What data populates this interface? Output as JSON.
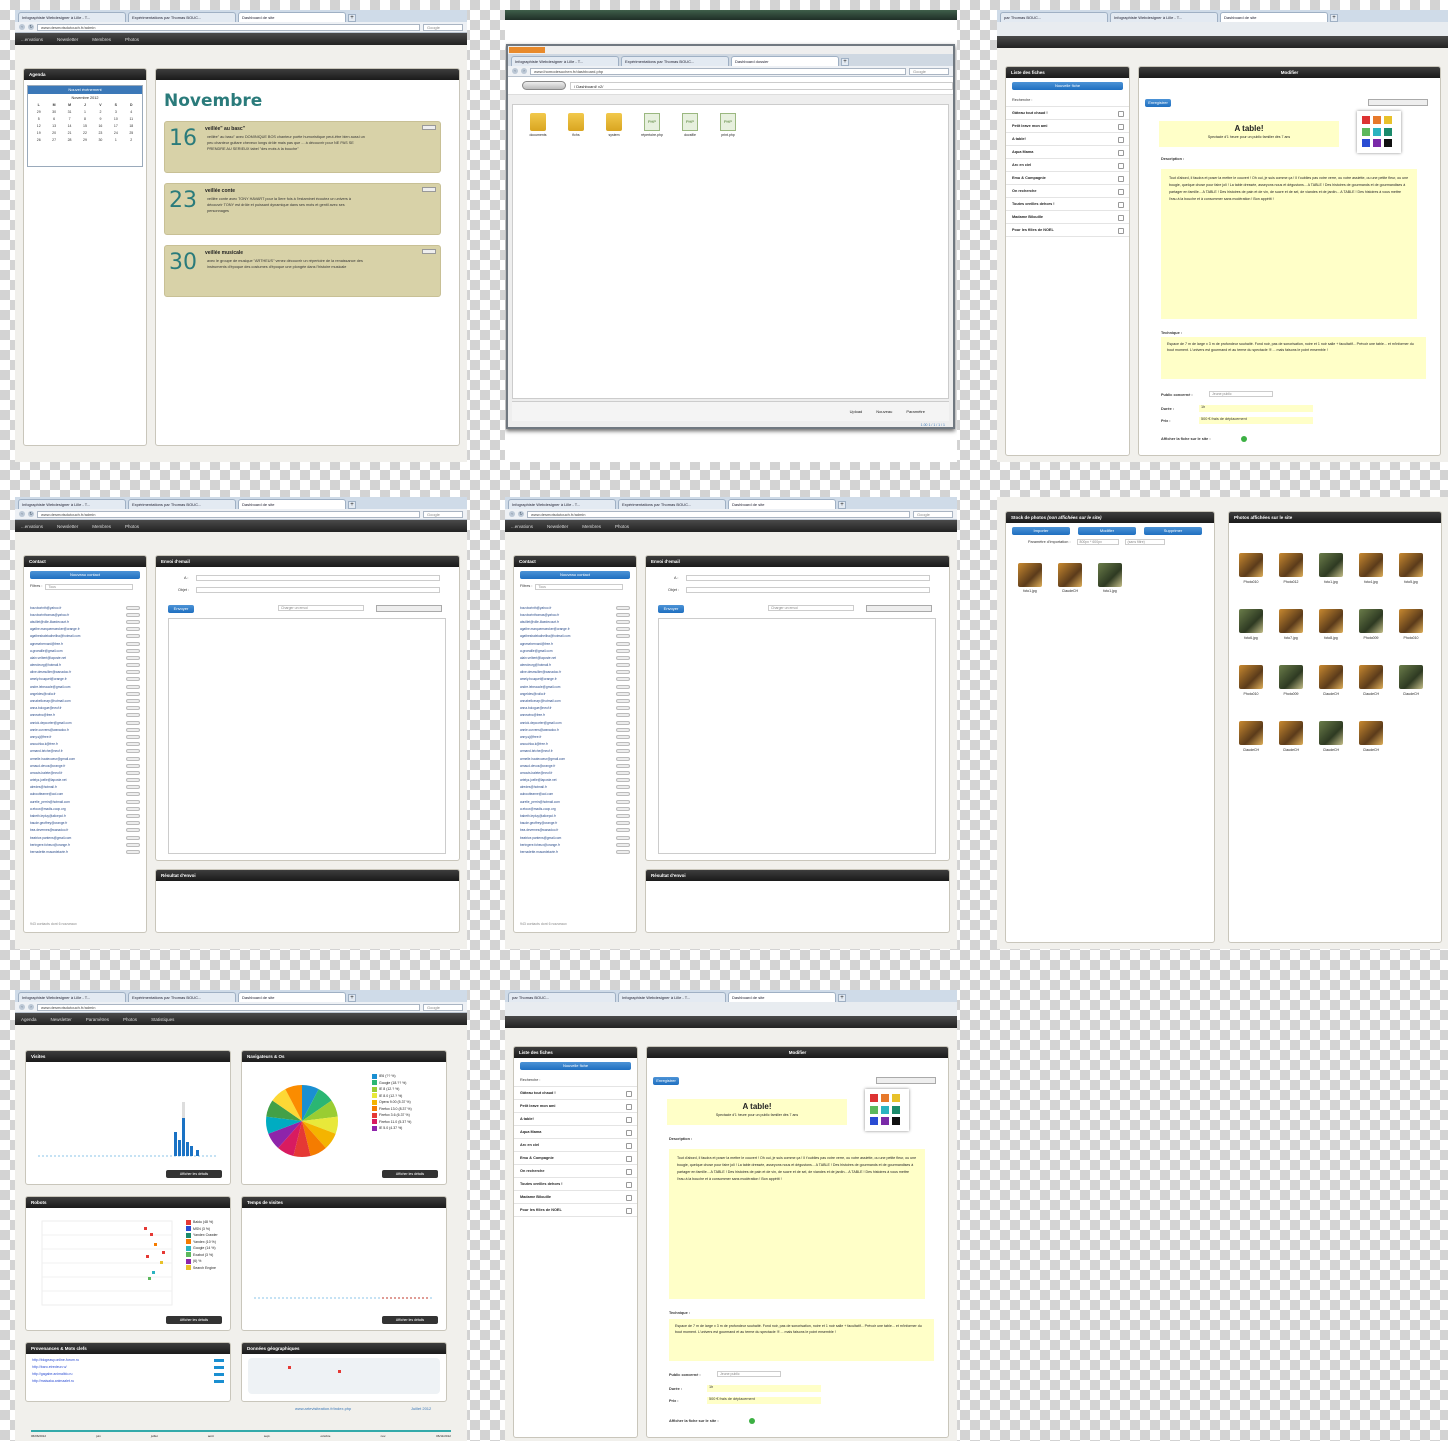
{
  "browser": {
    "tabs_a": [
      "Infographiste Webdesigner à Lille - T...",
      "Expérimentations par Thomas BOUC...",
      "Dashboard de site"
    ],
    "tabs_b": [
      "Infographiste Webdesigner à Lille - T...",
      "Expérimentations par Thomas BOUC...",
      "Dashboard dossier"
    ],
    "tabs_c": [
      "par Thomas BOUC...",
      "Infographiste Webdesigner à Lille - T...",
      "Dashboard de site"
    ],
    "url": "www.desmotsdutouch.fr/admin",
    "url_fm": "www.lhomodesuchen.fr/dashboard.php",
    "search": "Google"
  },
  "nav": {
    "a": [
      "...ervations",
      "Newsletter",
      "Membres",
      "Photos"
    ],
    "b": [
      "Agenda",
      "Newsletter",
      "Paramètres",
      "Photos",
      "Statistiques"
    ]
  },
  "agenda": {
    "panel_title": "Agenda",
    "new_event": "Nouvel événement",
    "cal_title": "Novembre 2012",
    "weekdays": [
      "L",
      "M",
      "M",
      "J",
      "V",
      "S",
      "D"
    ],
    "days": [
      "29",
      "30",
      "31",
      "1",
      "2",
      "3",
      "4",
      "5",
      "6",
      "7",
      "8",
      "9",
      "10",
      "11",
      "12",
      "13",
      "14",
      "15",
      "16",
      "17",
      "18",
      "19",
      "20",
      "21",
      "22",
      "23",
      "24",
      "25",
      "26",
      "27",
      "28",
      "29",
      "30",
      "1",
      "2"
    ],
    "month": "Novembre",
    "events": [
      {
        "day": "16",
        "title": "veillée\" au basc\"",
        "text": "veillée\" au basc\" avec DOMINIQUE BOS chanteur poète humoristique peut-être bien aussi un peu chanteur guitare cheveux longs drôle mais pas que ... à découvrir pour NE PAS SE PRENDRE AU SERIEUX tabel \"des mots à la bouche\""
      },
      {
        "day": "23",
        "title": "veillée conte",
        "text": "veillée conte avec TONY HAVART pour la 5ere fois à l'estaminet écoutez un univers à découvrir TONY est drôle et puissant dynamique dans ses mots et gentil avec ses personnages"
      },
      {
        "day": "30",
        "title": "veillée musicale",
        "text": "avec le groupe de musique \"ARTHEUS\" venez découvrir un répertoire de la renaissance des instruments d'époque des costumes d'époque une plongée dans l'histoire musicale"
      }
    ]
  },
  "filemanager": {
    "address": "/ Dashboard/ v2/",
    "items": [
      "documents",
      "fichs",
      "system",
      "répertoire.php",
      "docsfile",
      "print.php"
    ],
    "footer": [
      "Upload",
      "Nouveau",
      "Paramètre"
    ],
    "status": "1.00 1 / 1 / 1 / 1"
  },
  "fiche": {
    "list_title": "Liste des fiches",
    "new_fiche": "Nouvelle fiche",
    "search_label": "Recherche :",
    "items": [
      "Gâteau tout chaud !",
      "Petit leave mon ami",
      "A table!",
      "Aqua Mama",
      "Arc en ciel",
      "Emu & Compagnie",
      "On recherche",
      "Toutes oreilles dehors !",
      "Madame Bilouille",
      "Pour les filles de NOEL"
    ],
    "edit_title": "Modifier",
    "save": "Enregistrer",
    "heading": "A table!",
    "subtitle": "Spectacle d'1 heure pour un public familier dès 7 ans",
    "description_label": "Description :",
    "description": "Tout d'abord, il faudra et poser la mettre le couvert ! Oh oui, je suis comme ça ! Il t'oublies pas votre verre, ou votre assiette, ou une petite fleur, ou une bougie, quelque chose pour faire joli ! La table dressée, asseyons nous et dégustons... A TABLE ! Des histoires de gourmands et de gourmandises à partager en famille... A TABLE ! Des histoires de pain et de vin, de sucre et de sel, de viandes et de jardin... A TABLE ! Des histoires à vous mettre l'eau à la bouche et à consommer sans modération ! Bon appétit !",
    "technique_label": "Technique :",
    "technique": "Espace de 7 m de large x 3 m de profondeur souhaité. Fond noir, pas de sonorisation, noire et 1 noir salle + facultatif... Prévoir une table... et m'informer du bout moment. L'univers est gourmand et au terme du spectacle !!! ... mais faisons le point ensemble !",
    "public_label": "Public concerné :",
    "public_value": "Jeune public",
    "duree_label": "Durée :",
    "duree_value": "1h",
    "prix_label": "Prix :",
    "prix_value": "500 € frais de déplacement",
    "show_label": "Afficher la fiche sur le site :",
    "colors": [
      "#d33",
      "#e7792b",
      "#e8c12a",
      "#5cb85c",
      "#2bb3c0",
      "#1b8a6b",
      "#2a4cd3",
      "#7a2aa8",
      "#111"
    ]
  },
  "contacts": {
    "panel_title": "Contact",
    "new_contact": "Nouveau contact",
    "filter_label": "Filtres :",
    "filter_value": "Tous",
    "emails": [
      "bouvborinth@yahoo.fr",
      "bouvborinthomas@yahoo.fr",
      "abuillet@ville-lilaedecourt.fr",
      "agathe.marquemaecker@orange.fr",
      "agathesbalekaiheilha@hotmail.com",
      "agnesebernard@free.fr",
      "a.groeaille@gmail.com",
      "alain.velbert@laposte.net",
      "aleecleurg@hotmail.fr",
      "aline.desmullier@wanadoo.fr",
      "amely.bouquet@orange.fr",
      "andre.lebeaucle@gmail.com",
      "angeldes@voila.fr",
      "annabelloeurp@hotmail.com",
      "anna.bologue@neuf.fr",
      "annewinc@free.fr",
      "annick.depoorter@gmail.com",
      "annie.curvens@wanadoo.fr",
      "anny.sj@free.fr",
      "anouchka.k@free.fr",
      "armand.briche@neuf.fr",
      "armelle.hautecoeur@gmail.com",
      "arnaud.devos@orange.fr",
      "arnouts.balete@neuf.fr",
      "artelyz.joelle@laposte.net",
      "alredes@hotmail.fr",
      "aubouttearne@aol.com",
      "aurelie_perrin@hotmail.com",
      "a.etoux@madis-coop.org",
      "babeth.lepluy@alicepol.fr",
      "baude.geoffrey@orange.fr",
      "bea.devernes@wanadoo.fr",
      "beatrice.pantens@gmail.com",
      "beringere.foheux@orange.fr",
      "bernadette.musardelavie.fr"
    ],
    "footer": "943 contacts dont 6 nouveaux",
    "mail_title": "Envoi d'email",
    "to_label": "A :",
    "subject_label": "Objet :",
    "send": "Envoyer",
    "template": "Charger un envoi",
    "result_title": "Résultat d'envoi"
  },
  "photos": {
    "stock_title": "Stock de photos",
    "stock_sub": "(non affichées sur le site)",
    "import": "Importer",
    "modify": "Modifier",
    "delete": "Supprimer",
    "import_params": "Paramètre d'importation :",
    "size": "800px * 600px",
    "sort": "(sans filtre)",
    "stock": [
      "foto1.jpg",
      "ClaudeCH",
      "foto1.jpg"
    ],
    "shown_title": "Photos affichées sur le site",
    "shown": [
      "Photo010",
      "Photo012",
      "foto1.jpg",
      "foto4.jpg",
      "foto5.jpg",
      "foto6.jpg",
      "foto7.jpg",
      "foto8.jpg",
      "Photo009",
      "Photo010",
      "Photo010",
      "Photo009",
      "ClaudeCH",
      "ClaudeCH",
      "ClaudeCH",
      "ClaudeCH",
      "ClaudeCH",
      "ClaudeCH",
      "ClaudeCH"
    ]
  },
  "stats": {
    "visits_title": "Visites",
    "nav_title": "Navigateurs & Os",
    "robots_title": "Robots",
    "time_title": "Temps de visites",
    "prov_title": "Provenances & Mots clefs",
    "geo_title": "Données géographiques",
    "details": "Afficher les détails",
    "browsers": [
      "IE6 (?? %)",
      "Google (18.?? %)",
      "IE 8 (12.? %)",
      "IE 8.0 (12.? %)",
      "Opera 9.00 (5.37 %)",
      "Firefox 13.0 (8.37 %)",
      "Firefox 3.6 (6.37 %)",
      "Firefox 11.0 (5.37 %)",
      "IE 5.0 (4.37 %)"
    ],
    "browser_colors": [
      "#1a8fd1",
      "#2bb673",
      "#9acd32",
      "#e8e83a",
      "#f4b400",
      "#f57c00",
      "#e53935",
      "#d81b60",
      "#8e24aa"
    ],
    "robots": [
      "Baidu (48 %)",
      "MSN (3 %)",
      "Yandex Crawler",
      "Yandex (10 %)",
      "Google (14 %)",
      "Exabot (3 %)",
      "(6) %",
      "Search Engine"
    ],
    "robot_colors": [
      "#e53935",
      "#2a4cd3",
      "#1b8a6b",
      "#f57c00",
      "#2bb3c0",
      "#5cb85c",
      "#8e24aa",
      "#e8c12a"
    ],
    "referrers": [
      "http://blogeasy.online-forum.ru",
      "http://baro.etredeur.ru/",
      "http://gagabe.animalblo.ru",
      "http://maisaka.animaalet.ru"
    ],
    "footer_url": "www.artevisiteation.fr/index.php",
    "footer_date": "Juillet 2012",
    "timeline": [
      "06/06/2012",
      "juin",
      "juillet",
      "août",
      "sept.",
      "octobre",
      "nov.",
      "06/11/2012"
    ]
  }
}
